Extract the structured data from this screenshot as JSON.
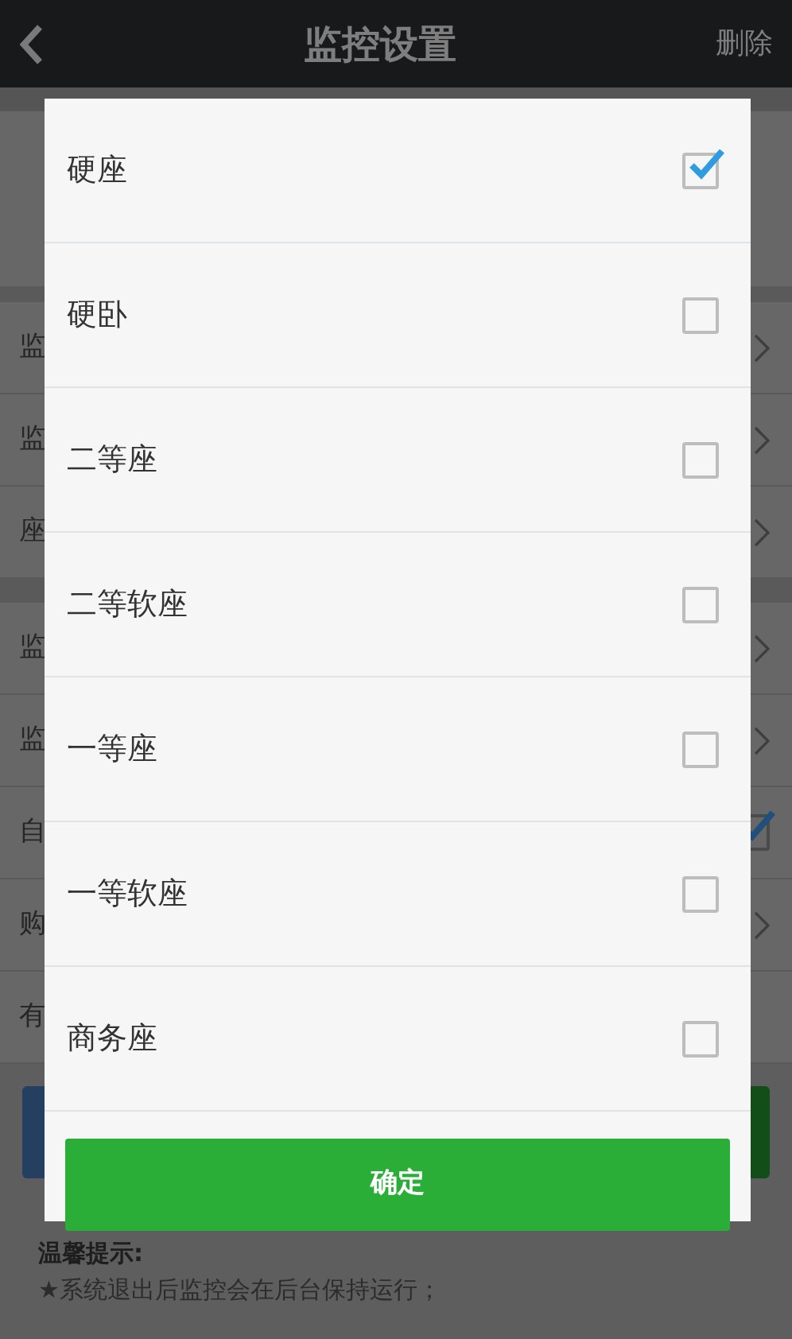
{
  "header": {
    "title": "监控设置",
    "action": "删除"
  },
  "background_sections": [
    {
      "rows": [
        {
          "label": "监",
          "kind": "chevron"
        },
        {
          "label": "监",
          "kind": "chevron"
        },
        {
          "label": "座",
          "kind": "chevron"
        }
      ]
    },
    {
      "rows": [
        {
          "label": "监",
          "kind": "chevron"
        },
        {
          "label": "监",
          "kind": "chevron"
        },
        {
          "label": "自",
          "kind": "checkbox",
          "checked": true
        },
        {
          "label": "购",
          "kind": "chevron"
        },
        {
          "label": "有",
          "kind": "none"
        }
      ]
    }
  ],
  "tips": {
    "title": "温馨提示:",
    "lines": [
      "★系统退出后监控会在后台保持运行；"
    ]
  },
  "dialog": {
    "options": [
      {
        "label": "硬座",
        "checked": true
      },
      {
        "label": "硬卧",
        "checked": false
      },
      {
        "label": "二等座",
        "checked": false
      },
      {
        "label": "二等软座",
        "checked": false
      },
      {
        "label": "一等座",
        "checked": false
      },
      {
        "label": "一等软座",
        "checked": false
      },
      {
        "label": "商务座",
        "checked": false
      }
    ],
    "confirm": "确定"
  }
}
